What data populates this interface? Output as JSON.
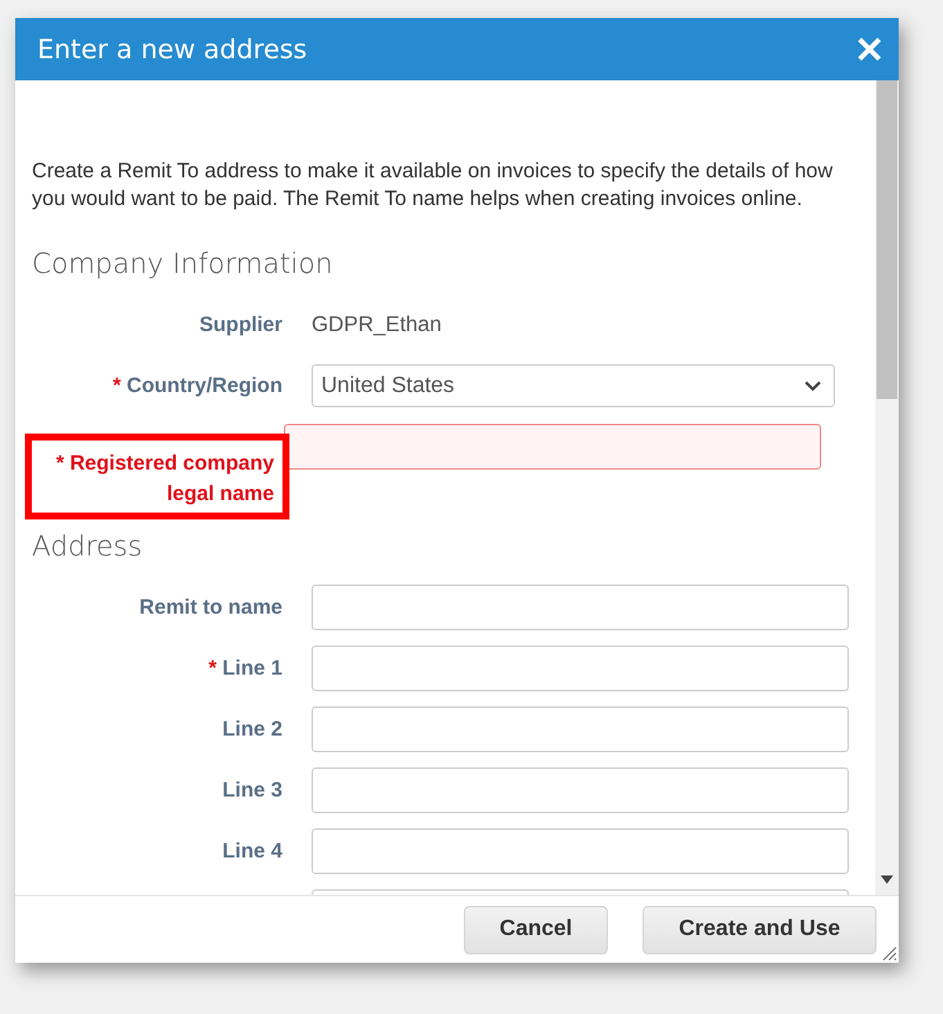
{
  "dialog": {
    "title": "Enter a new address",
    "close_icon": "✕"
  },
  "intro": "Create a Remit To address to make it available on invoices to specify the details of how you would want to be paid. The Remit To name helps when creating invoices online.",
  "sections": [
    {
      "heading": "Company Information",
      "fields": [
        {
          "kind": "static",
          "label": "Supplier",
          "value": "GDPR_Ethan"
        },
        {
          "kind": "select",
          "label": "Country/Region",
          "mark": "*",
          "value": "United States"
        },
        {
          "kind": "input",
          "label": "Registered company legal name",
          "mark": "*",
          "error": true,
          "highlighted": true
        }
      ]
    },
    {
      "heading": "Address",
      "fields": [
        {
          "kind": "input",
          "label": "Remit to name",
          "error": false
        },
        {
          "kind": "input",
          "label": "Line 1",
          "mark": "*",
          "error": false
        },
        {
          "kind": "input",
          "label": "Line 2",
          "error": false
        },
        {
          "kind": "input",
          "label": "Line 3",
          "error": false
        },
        {
          "kind": "input",
          "label": "Line 4",
          "error": false
        },
        {
          "kind": "input",
          "error": false
        }
      ]
    }
  ],
  "buttons": [
    {
      "label": "Cancel"
    },
    {
      "label": "Create and Use"
    }
  ]
}
